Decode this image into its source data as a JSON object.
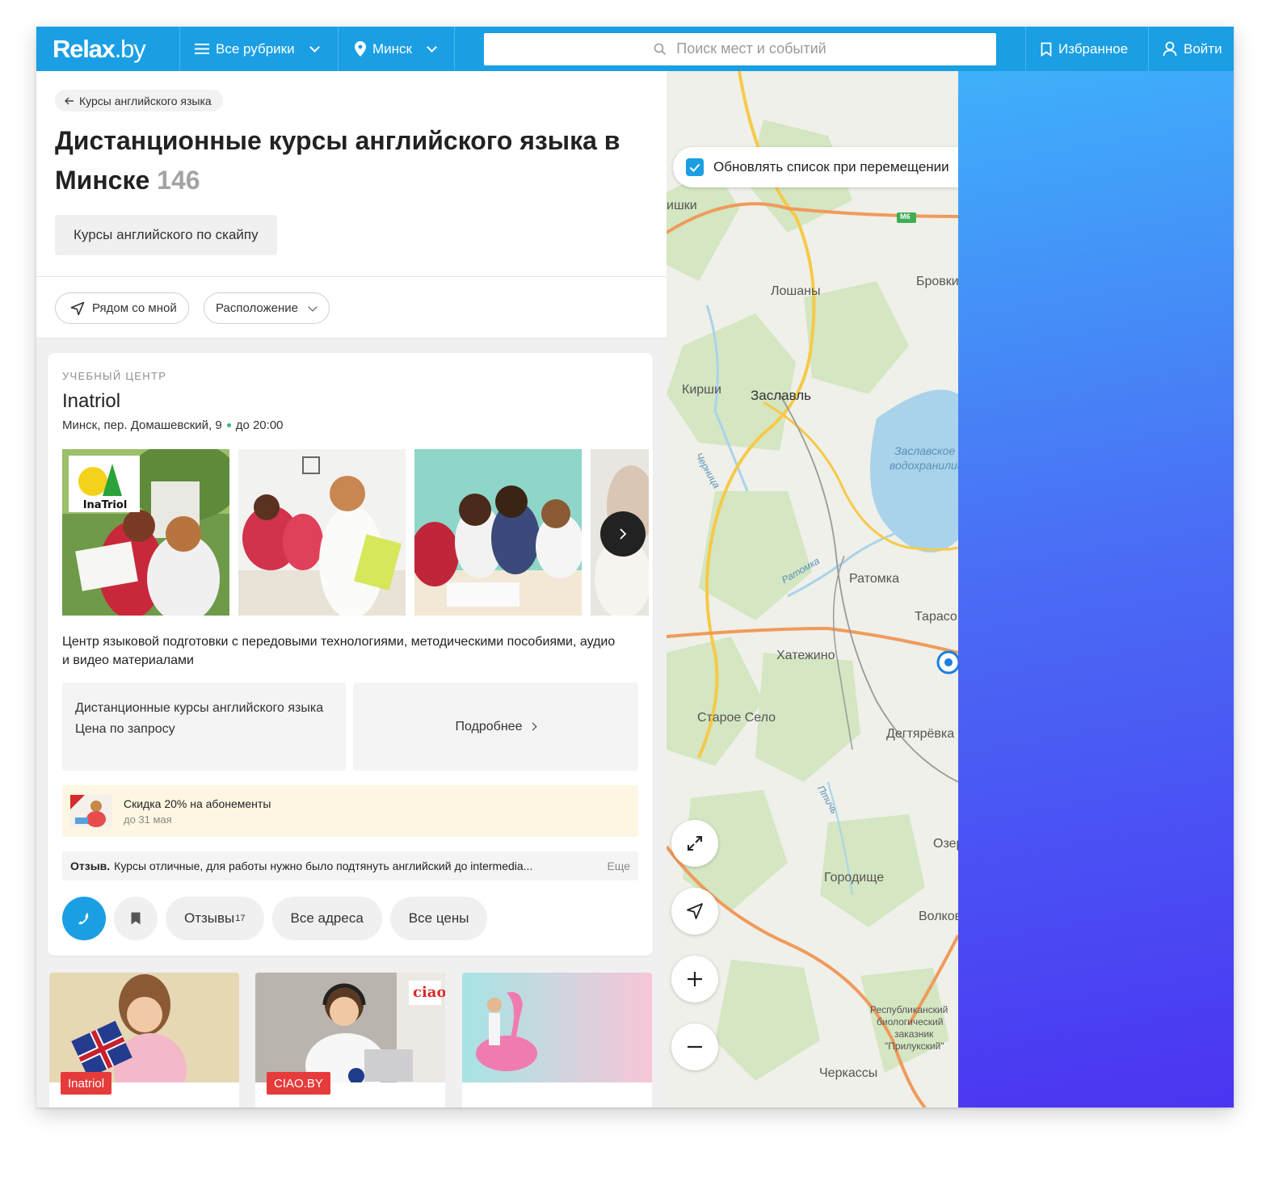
{
  "header": {
    "logo": {
      "main": "Relax",
      "suffix": ".by"
    },
    "rubrics_label": "Все рубрики",
    "city_label": "Минск",
    "search_placeholder": "Поиск мест и событий",
    "favorites_label": "Избранное",
    "login_label": "Войти",
    "color": "#1a9fe4"
  },
  "listing": {
    "back_label": "Курсы английского языка",
    "title": "Дистанционные курсы английского языка в Минске",
    "count": "146",
    "tags": [
      "Курсы английского по скайпу"
    ],
    "filters": {
      "near_me": "Рядом со мной",
      "location": "Расположение"
    }
  },
  "card": {
    "kind": "УЧЕБНЫЙ ЦЕНТР",
    "name": "Inatriol",
    "address": "Минск, пер. Домашевский, 9",
    "hours": "до 20:00",
    "photo_logo_text": "InaTriol",
    "description": "Центр языковой подготовки с передовыми технологиями, методическими пособиями, аудио и видео материалами",
    "offer": {
      "name": "Дистанционные курсы английского языка",
      "price": "Цена по запросу"
    },
    "more_label": "Подробнее",
    "promo": {
      "title": "Скидка 20% на абонементы",
      "until": "до 31 мая"
    },
    "review": {
      "label": "Отзыв.",
      "text": "Курсы отличные, для работы нужно было подтянуть английский до intermedia...",
      "more": "Еще"
    },
    "actions": {
      "reviews": "Отзывы",
      "reviews_count": "17",
      "all_addresses": "Все адреса",
      "all_prices": "Все цены"
    }
  },
  "mini_cards": [
    {
      "badge": "Inatriol"
    },
    {
      "badge": "CIAO.BY",
      "sign": "ciao"
    },
    {
      "badge": ""
    }
  ],
  "map": {
    "update_checkbox": "Обновлять список при перемещении",
    "labels": [
      {
        "name": "ишки"
      },
      {
        "name": "Лошаны"
      },
      {
        "name": "Бровки"
      },
      {
        "name": "Кирши"
      },
      {
        "name": "Заславль"
      },
      {
        "name": "Заславское"
      },
      {
        "name": "водохранилище"
      },
      {
        "name": "Ратомка"
      },
      {
        "name": "Тарасово"
      },
      {
        "name": "Хатежино"
      },
      {
        "name": "Старое Село"
      },
      {
        "name": "Дегтярёвка"
      },
      {
        "name": "Озерцо"
      },
      {
        "name": "Городище"
      },
      {
        "name": "Волковичи"
      },
      {
        "name": "Черкассы"
      },
      {
        "name": "Республиканский"
      },
      {
        "name": "биологический"
      },
      {
        "name": "заказник"
      },
      {
        "name": "\"Прилукский\""
      },
      {
        "name": "Черница"
      },
      {
        "name": "Ратомка"
      },
      {
        "name": "Птичь"
      },
      {
        "name": "М6"
      }
    ]
  }
}
